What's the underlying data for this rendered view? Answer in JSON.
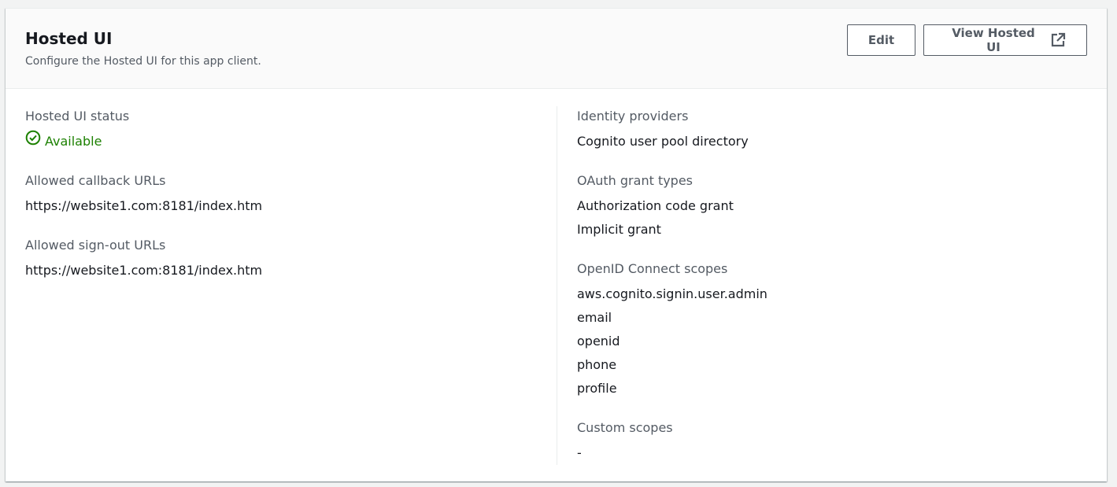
{
  "header": {
    "title": "Hosted UI",
    "description": "Configure the Hosted UI for this app client.",
    "edit_label": "Edit",
    "view_label": "View Hosted UI"
  },
  "left": {
    "status": {
      "label": "Hosted UI status",
      "value": "Available"
    },
    "callback": {
      "label": "Allowed callback URLs",
      "values": [
        "https://website1.com:8181/index.htm"
      ]
    },
    "signout": {
      "label": "Allowed sign-out URLs",
      "values": [
        "https://website1.com:8181/index.htm"
      ]
    }
  },
  "right": {
    "identity": {
      "label": "Identity providers",
      "values": [
        "Cognito user pool directory"
      ]
    },
    "oauth": {
      "label": "OAuth grant types",
      "values": [
        "Authorization code grant",
        "Implicit grant"
      ]
    },
    "openid": {
      "label": "OpenID Connect scopes",
      "values": [
        "aws.cognito.signin.user.admin",
        "email",
        "openid",
        "phone",
        "profile"
      ]
    },
    "custom": {
      "label": "Custom scopes",
      "values": [
        "-"
      ]
    }
  },
  "colors": {
    "status_green": "#1d8102",
    "text_primary": "#16191f",
    "text_secondary": "#545b64",
    "header_bg": "#fafafa",
    "page_bg": "#f2f3f3"
  },
  "icons": {
    "status": "check-circle-icon",
    "external": "external-link-icon"
  }
}
